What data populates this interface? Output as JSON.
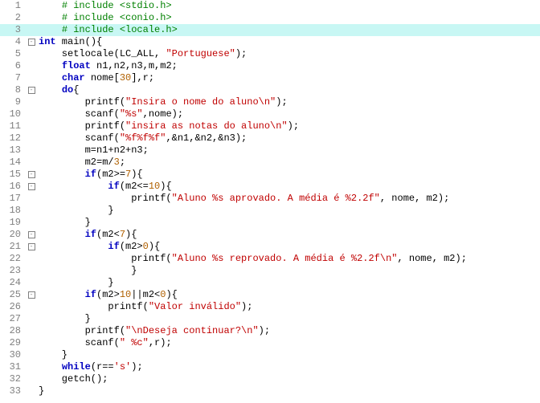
{
  "lines": [
    {
      "n": 1,
      "marked": false,
      "fold": "",
      "tokens": [
        [
          "    ",
          "plain"
        ],
        [
          "# include <stdio.h>",
          "preproc"
        ]
      ]
    },
    {
      "n": 2,
      "marked": false,
      "fold": "",
      "tokens": [
        [
          "    ",
          "plain"
        ],
        [
          "# include <conio.h>",
          "preproc"
        ]
      ]
    },
    {
      "n": 3,
      "marked": true,
      "fold": "",
      "tokens": [
        [
          "    ",
          "plain"
        ],
        [
          "# include <locale.h>",
          "preproc"
        ]
      ]
    },
    {
      "n": 4,
      "marked": false,
      "fold": "-",
      "tokens": [
        [
          "int",
          "kw"
        ],
        [
          " main(){",
          "plain"
        ]
      ]
    },
    {
      "n": 5,
      "marked": false,
      "fold": "",
      "tokens": [
        [
          "    setlocale(LC_ALL, ",
          "plain"
        ],
        [
          "\"Portuguese\"",
          "str"
        ],
        [
          ");",
          "plain"
        ]
      ]
    },
    {
      "n": 6,
      "marked": false,
      "fold": "",
      "tokens": [
        [
          "    ",
          "plain"
        ],
        [
          "float",
          "kw"
        ],
        [
          " n1,n2,n3,m,m2;",
          "plain"
        ]
      ]
    },
    {
      "n": 7,
      "marked": false,
      "fold": "",
      "tokens": [
        [
          "    ",
          "plain"
        ],
        [
          "char",
          "kw"
        ],
        [
          " nome[",
          "plain"
        ],
        [
          "30",
          "num"
        ],
        [
          "],r;",
          "plain"
        ]
      ]
    },
    {
      "n": 8,
      "marked": false,
      "fold": "-",
      "tokens": [
        [
          "    ",
          "plain"
        ],
        [
          "do",
          "kw"
        ],
        [
          "{",
          "plain"
        ]
      ]
    },
    {
      "n": 9,
      "marked": false,
      "fold": "",
      "tokens": [
        [
          "        printf(",
          "plain"
        ],
        [
          "\"Insira o nome do aluno\\n\"",
          "str"
        ],
        [
          ");",
          "plain"
        ]
      ]
    },
    {
      "n": 10,
      "marked": false,
      "fold": "",
      "tokens": [
        [
          "        scanf(",
          "plain"
        ],
        [
          "\"%s\"",
          "str"
        ],
        [
          ",nome);",
          "plain"
        ]
      ]
    },
    {
      "n": 11,
      "marked": false,
      "fold": "",
      "tokens": [
        [
          "        printf(",
          "plain"
        ],
        [
          "\"insira as notas do aluno\\n\"",
          "str"
        ],
        [
          ");",
          "plain"
        ]
      ]
    },
    {
      "n": 12,
      "marked": false,
      "fold": "",
      "tokens": [
        [
          "        scanf(",
          "plain"
        ],
        [
          "\"%f%f%f\"",
          "str"
        ],
        [
          ",&n1,&n2,&n3);",
          "plain"
        ]
      ]
    },
    {
      "n": 13,
      "marked": false,
      "fold": "",
      "tokens": [
        [
          "        m=n1+n2+n3;",
          "plain"
        ]
      ]
    },
    {
      "n": 14,
      "marked": false,
      "fold": "",
      "tokens": [
        [
          "        m2=m/",
          "plain"
        ],
        [
          "3",
          "num"
        ],
        [
          ";",
          "plain"
        ]
      ]
    },
    {
      "n": 15,
      "marked": false,
      "fold": "-",
      "tokens": [
        [
          "        ",
          "plain"
        ],
        [
          "if",
          "kw"
        ],
        [
          "(m2>=",
          "plain"
        ],
        [
          "7",
          "num"
        ],
        [
          "){",
          "plain"
        ]
      ]
    },
    {
      "n": 16,
      "marked": false,
      "fold": "-",
      "tokens": [
        [
          "            ",
          "plain"
        ],
        [
          "if",
          "kw"
        ],
        [
          "(m2<=",
          "plain"
        ],
        [
          "10",
          "num"
        ],
        [
          "){",
          "plain"
        ]
      ]
    },
    {
      "n": 17,
      "marked": false,
      "fold": "",
      "tokens": [
        [
          "                printf(",
          "plain"
        ],
        [
          "\"Aluno %s aprovado. A média é %2.2f\"",
          "str"
        ],
        [
          ", nome, m2);",
          "plain"
        ]
      ]
    },
    {
      "n": 18,
      "marked": false,
      "fold": "",
      "tokens": [
        [
          "            }",
          "plain"
        ]
      ]
    },
    {
      "n": 19,
      "marked": false,
      "fold": "",
      "tokens": [
        [
          "        }",
          "plain"
        ]
      ]
    },
    {
      "n": 20,
      "marked": false,
      "fold": "-",
      "tokens": [
        [
          "        ",
          "plain"
        ],
        [
          "if",
          "kw"
        ],
        [
          "(m2<",
          "plain"
        ],
        [
          "7",
          "num"
        ],
        [
          "){",
          "plain"
        ]
      ]
    },
    {
      "n": 21,
      "marked": false,
      "fold": "-",
      "tokens": [
        [
          "            ",
          "plain"
        ],
        [
          "if",
          "kw"
        ],
        [
          "(m2>",
          "plain"
        ],
        [
          "0",
          "num"
        ],
        [
          "){",
          "plain"
        ]
      ]
    },
    {
      "n": 22,
      "marked": false,
      "fold": "",
      "tokens": [
        [
          "                printf(",
          "plain"
        ],
        [
          "\"Aluno %s reprovado. A média é %2.2f\\n\"",
          "str"
        ],
        [
          ", nome, m2);",
          "plain"
        ]
      ]
    },
    {
      "n": 23,
      "marked": false,
      "fold": "",
      "tokens": [
        [
          "                }",
          "plain"
        ]
      ]
    },
    {
      "n": 24,
      "marked": false,
      "fold": "",
      "tokens": [
        [
          "            }",
          "plain"
        ]
      ]
    },
    {
      "n": 25,
      "marked": false,
      "fold": "-",
      "tokens": [
        [
          "        ",
          "plain"
        ],
        [
          "if",
          "kw"
        ],
        [
          "(m2>",
          "plain"
        ],
        [
          "10",
          "num"
        ],
        [
          "||m2<",
          "plain"
        ],
        [
          "0",
          "num"
        ],
        [
          "){",
          "plain"
        ]
      ]
    },
    {
      "n": 26,
      "marked": false,
      "fold": "",
      "tokens": [
        [
          "            printf(",
          "plain"
        ],
        [
          "\"Valor inválido\"",
          "str"
        ],
        [
          ");",
          "plain"
        ]
      ]
    },
    {
      "n": 27,
      "marked": false,
      "fold": "",
      "tokens": [
        [
          "        }",
          "plain"
        ]
      ]
    },
    {
      "n": 28,
      "marked": false,
      "fold": "",
      "tokens": [
        [
          "        printf(",
          "plain"
        ],
        [
          "\"\\nDeseja continuar?\\n\"",
          "str"
        ],
        [
          ");",
          "plain"
        ]
      ]
    },
    {
      "n": 29,
      "marked": false,
      "fold": "",
      "tokens": [
        [
          "        scanf(",
          "plain"
        ],
        [
          "\" %c\"",
          "str"
        ],
        [
          ",r);",
          "plain"
        ]
      ]
    },
    {
      "n": 30,
      "marked": false,
      "fold": "",
      "tokens": [
        [
          "    }",
          "plain"
        ]
      ]
    },
    {
      "n": 31,
      "marked": false,
      "fold": "",
      "tokens": [
        [
          "    ",
          "plain"
        ],
        [
          "while",
          "kw"
        ],
        [
          "(r==",
          "plain"
        ],
        [
          "'s'",
          "str"
        ],
        [
          ");",
          "plain"
        ]
      ]
    },
    {
      "n": 32,
      "marked": false,
      "fold": "",
      "tokens": [
        [
          "    getch();",
          "plain"
        ]
      ]
    },
    {
      "n": 33,
      "marked": false,
      "fold": "",
      "tokens": [
        [
          "}",
          "plain"
        ]
      ]
    }
  ]
}
